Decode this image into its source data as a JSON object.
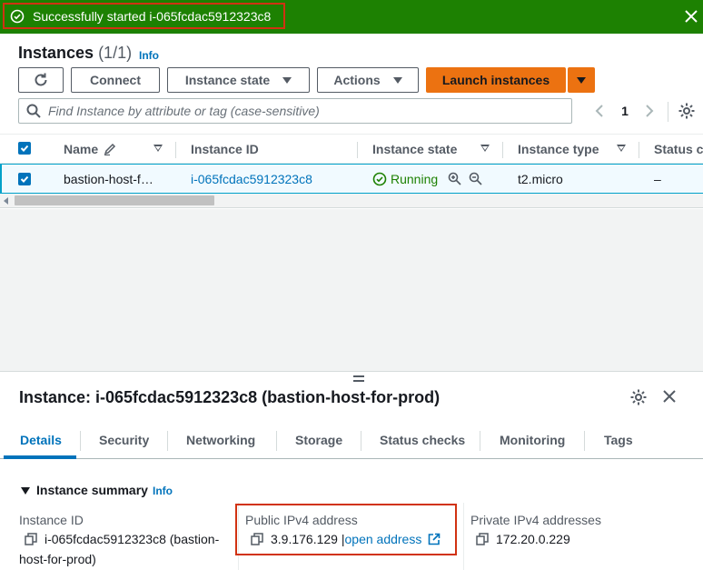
{
  "flash": {
    "message": "Successfully started i-065fcdac5912323c8"
  },
  "header": {
    "title": "Instances",
    "count": "(1/1)",
    "info": "Info"
  },
  "toolbar": {
    "connect": "Connect",
    "instance_state": "Instance state",
    "actions": "Actions",
    "launch": "Launch instances"
  },
  "search": {
    "placeholder": "Find Instance by attribute or tag (case-sensitive)"
  },
  "pagination": {
    "page": "1"
  },
  "table": {
    "columns": [
      "Name",
      "Instance ID",
      "Instance state",
      "Instance type",
      "Status ch"
    ],
    "rows": [
      {
        "name": "bastion-host-f…",
        "id": "i-065fcdac5912323c8",
        "state": "Running",
        "type": "t2.micro",
        "status": "–"
      }
    ]
  },
  "panel": {
    "title": "Instance: i-065fcdac5912323c8 (bastion-host-for-prod)",
    "tabs": [
      "Details",
      "Security",
      "Networking",
      "Storage",
      "Status checks",
      "Monitoring",
      "Tags"
    ],
    "summary_title": "Instance summary",
    "summary_info": "Info",
    "instance_id_label": "Instance ID",
    "instance_id_value_1": "i-065fcdac5912323c8 (bastion-",
    "instance_id_value_2": "host-for-prod)",
    "public_ip_label": "Public IPv4 address",
    "public_ip_value": "3.9.176.129",
    "public_ip_sep": "|",
    "open_address": "open address",
    "private_ip_label": "Private IPv4 addresses",
    "private_ip_value": "172.20.0.229"
  },
  "colors": {
    "success": "#1d8102",
    "link": "#0073bb",
    "primary": "#ec7211",
    "highlight": "#d13212"
  },
  "icons": [
    "check-circle-icon",
    "close-icon",
    "refresh-icon",
    "search-icon",
    "gear-icon",
    "edit-icon",
    "zoom-in-icon",
    "zoom-out-icon",
    "copy-icon",
    "external-link-icon"
  ]
}
